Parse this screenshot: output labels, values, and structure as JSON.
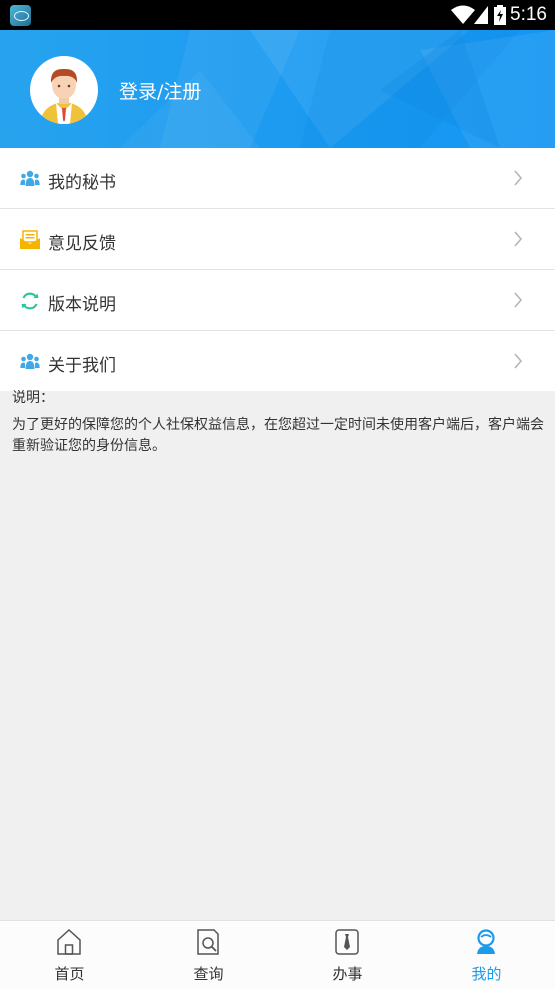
{
  "status_bar": {
    "time": "5:16",
    "icons": [
      "app-notification-icon",
      "wifi-icon",
      "signal-icon",
      "battery-icon"
    ]
  },
  "header": {
    "login_label": "登录/注册",
    "avatar": "user-avatar"
  },
  "menu": {
    "items": [
      {
        "label": "我的秘书",
        "icon": "people-icon",
        "icon_color": "#3fa9e8"
      },
      {
        "label": "意见反馈",
        "icon": "envelope-icon",
        "icon_color": "#f5b400"
      },
      {
        "label": "版本说明",
        "icon": "refresh-icon",
        "icon_color": "#2cc49a"
      },
      {
        "label": "关于我们",
        "icon": "people-icon",
        "icon_color": "#3fa9e8"
      }
    ]
  },
  "note": {
    "title": "说明：",
    "text": "为了更好的保障您的个人社保权益信息，在您超过一定时间未使用客户端后，客户端会重新验证您的身份信息。"
  },
  "tabbar": {
    "tabs": [
      {
        "label": "首页",
        "icon": "home-icon",
        "active": false
      },
      {
        "label": "查询",
        "icon": "search-doc-icon",
        "active": false
      },
      {
        "label": "办事",
        "icon": "tie-icon",
        "active": false
      },
      {
        "label": "我的",
        "icon": "user-icon",
        "active": true
      }
    ]
  },
  "colors": {
    "accent": "#1b9bec",
    "header_blue": "#1e9cf0",
    "background": "#f0f0f0"
  }
}
